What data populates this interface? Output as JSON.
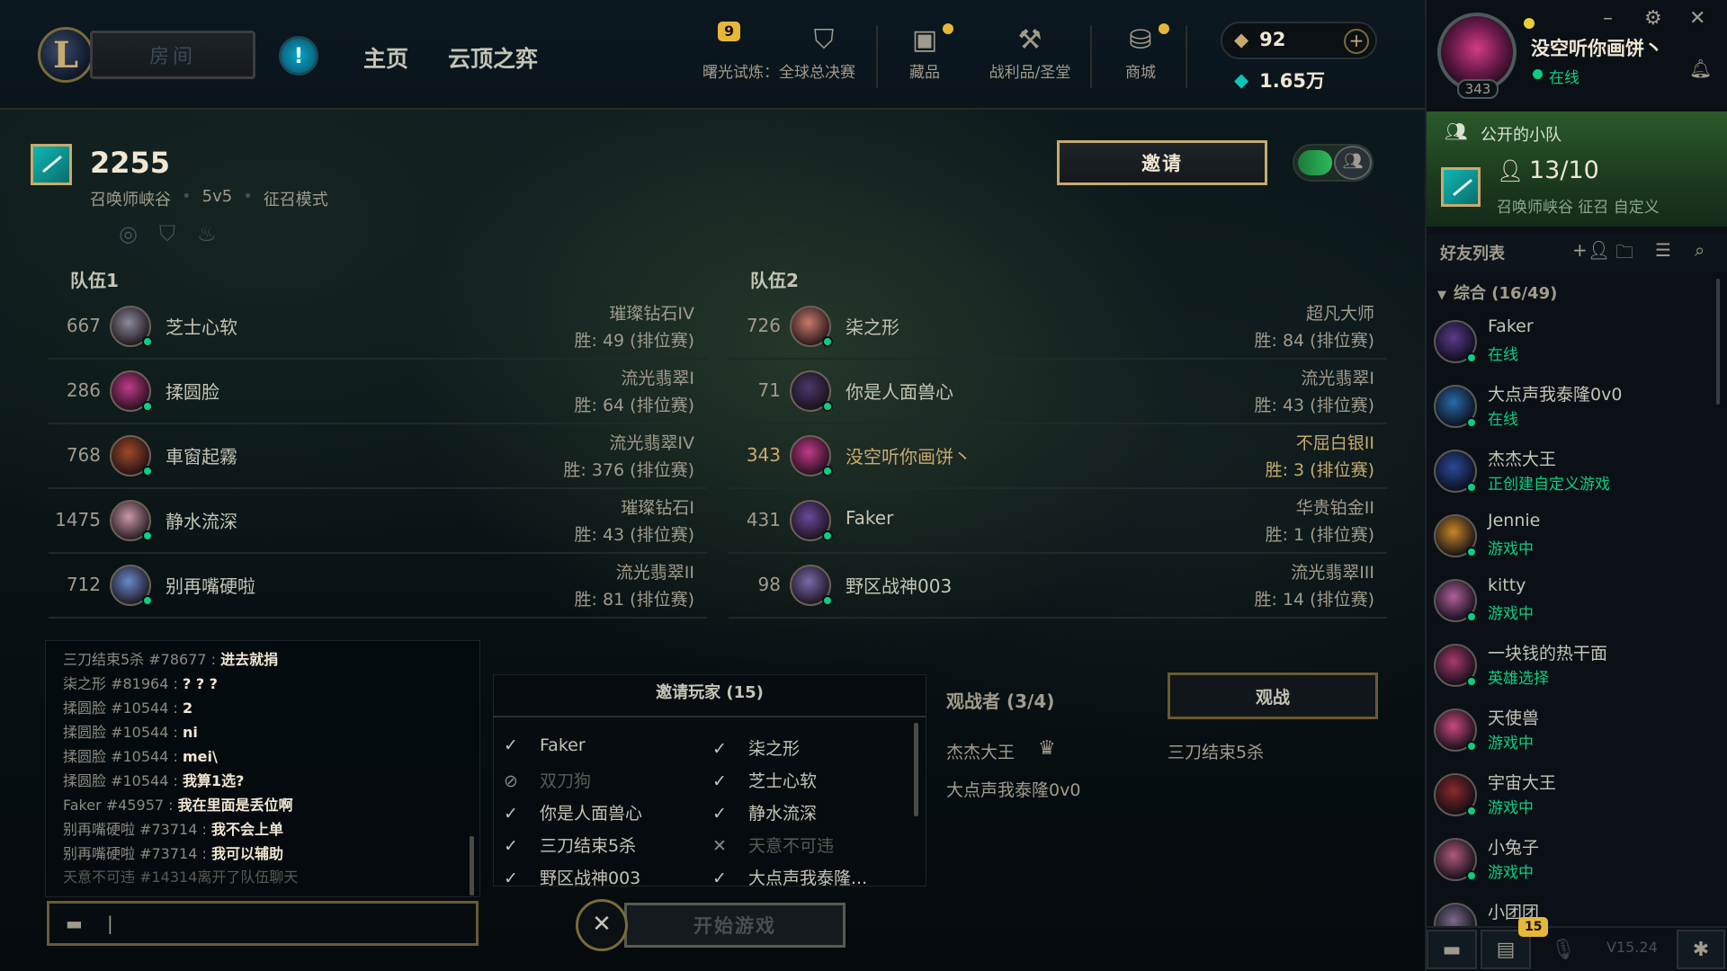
{
  "nav": {
    "room_label": "房间",
    "home": "主页",
    "tft": "云顶之弈",
    "event_badge": "9",
    "event_label": "曙光试炼：全球总决赛",
    "collection": "藏品",
    "loot": "战利品/圣堂",
    "store": "商城",
    "rp": "92",
    "be": "1.65万"
  },
  "profile": {
    "name": "没空听你画饼丶",
    "level": "343",
    "status": "在线"
  },
  "party": {
    "title": "公开的小队",
    "count": "13/10",
    "meta": "召唤师峡谷 征召 自定义"
  },
  "friends": {
    "title": "好友列表",
    "group": "综合 (16/49)",
    "list": [
      {
        "name": "Faker",
        "status": "在线",
        "color": "#0acf83"
      },
      {
        "name": "大点声我泰隆0v0",
        "status": "在线",
        "color": "#0acf83"
      },
      {
        "name": "杰杰大王",
        "status": "正创建自定义游戏",
        "color": "#0acf83"
      },
      {
        "name": "Jennie",
        "status": "游戏中",
        "color": "#0acf83"
      },
      {
        "name": "kitty",
        "status": "游戏中",
        "color": "#0acf83"
      },
      {
        "name": "一块钱的热干面",
        "status": "英雄选择",
        "color": "#0acf83"
      },
      {
        "name": "天使兽",
        "status": "游戏中",
        "color": "#0acf83"
      },
      {
        "name": "宇宙大王",
        "status": "游戏中",
        "color": "#0acf83"
      },
      {
        "name": "小兔子",
        "status": "游戏中",
        "color": "#0acf83"
      },
      {
        "name": "小团团",
        "status": "",
        "color": "#0acf83"
      }
    ]
  },
  "bottom": {
    "notif_count": "15",
    "version": "V15.24"
  },
  "lobby": {
    "id": "2255",
    "map": "召唤师峡谷",
    "size": "5v5",
    "mode": "征召模式",
    "invite_label": "邀请"
  },
  "teams": [
    {
      "label": "队伍1",
      "players": [
        {
          "level": "667",
          "name": "芝士心软",
          "rank": "璀璨钻石IV",
          "wins": "胜:  49  (排位赛)"
        },
        {
          "level": "286",
          "name": "揉圆脸",
          "rank": "流光翡翠I",
          "wins": "胜:  64  (排位赛)"
        },
        {
          "level": "768",
          "name": "車窗起霧",
          "rank": "流光翡翠IV",
          "wins": "胜:  376  (排位赛)"
        },
        {
          "level": "1475",
          "name": "静水流深",
          "rank": "璀璨钻石I",
          "wins": "胜:  43  (排位赛)"
        },
        {
          "level": "712",
          "name": "别再嘴硬啦",
          "rank": "流光翡翠II",
          "wins": "胜:  81  (排位赛)"
        }
      ]
    },
    {
      "label": "队伍2",
      "players": [
        {
          "level": "726",
          "name": "柒之形",
          "rank": "超凡大师",
          "wins": "胜:  84  (排位赛)"
        },
        {
          "level": "71",
          "name": "你是人面兽心",
          "rank": "流光翡翠I",
          "wins": "胜:  43  (排位赛)"
        },
        {
          "level": "343",
          "name": "没空听你画饼丶",
          "rank": "不屈白银II",
          "wins": "胜:  3  (排位赛)"
        },
        {
          "level": "431",
          "name": "Faker",
          "rank": "华贵铂金II",
          "wins": "胜:  1  (排位赛)"
        },
        {
          "level": "98",
          "name": "野区战神003",
          "rank": "流光翡翠III",
          "wins": "胜:  14  (排位赛)"
        }
      ]
    }
  ],
  "chat": {
    "lines": [
      {
        "who": "三刀结束5杀 #78677 : ",
        "msg": "进去就捐"
      },
      {
        "who": "柒之形 #81964 : ",
        "msg": "? ? ?"
      },
      {
        "who": "揉圆脸 #10544 : ",
        "msg": "2"
      },
      {
        "who": "揉圆脸 #10544 : ",
        "msg": "ni"
      },
      {
        "who": "揉圆脸 #10544 : ",
        "msg": "mei\\"
      },
      {
        "who": "揉圆脸 #10544 : ",
        "msg": "我算1选?"
      },
      {
        "who": "Faker #45957 : ",
        "msg": "我在里面是丢位啊"
      },
      {
        "who": "别再嘴硬啦 #73714 : ",
        "msg": "我不会上单"
      },
      {
        "who": "别再嘴硬啦 #73714 : ",
        "msg": "我可以辅助"
      }
    ],
    "system": "天意不可违 #14314离开了队伍聊天",
    "input_value": "|"
  },
  "invited": {
    "title": "邀请玩家 (15)",
    "left": [
      {
        "mark": "✓",
        "name": "Faker",
        "dim": false
      },
      {
        "mark": "⊘",
        "name": "双刀狗",
        "dim": true
      },
      {
        "mark": "✓",
        "name": "你是人面兽心",
        "dim": false
      },
      {
        "mark": "✓",
        "name": "三刀结束5杀",
        "dim": false
      },
      {
        "mark": "✓",
        "name": "野区战神003",
        "dim": false
      }
    ],
    "right": [
      {
        "mark": "✓",
        "name": "柒之形",
        "dim": false
      },
      {
        "mark": "✓",
        "name": "芝士心软",
        "dim": false
      },
      {
        "mark": "✓",
        "name": "静水流深",
        "dim": false
      },
      {
        "mark": "✕",
        "name": "天意不可违",
        "dim": true
      },
      {
        "mark": "✓",
        "name": "大点声我泰隆...",
        "dim": false
      }
    ]
  },
  "spectators": {
    "title": "观战者 (3/4)",
    "button": "观战",
    "names": [
      "杰杰大王",
      "大点声我泰隆0v0",
      "三刀结束5杀"
    ]
  },
  "start": {
    "cancel_icon": "✕",
    "label": "开始游戏"
  }
}
